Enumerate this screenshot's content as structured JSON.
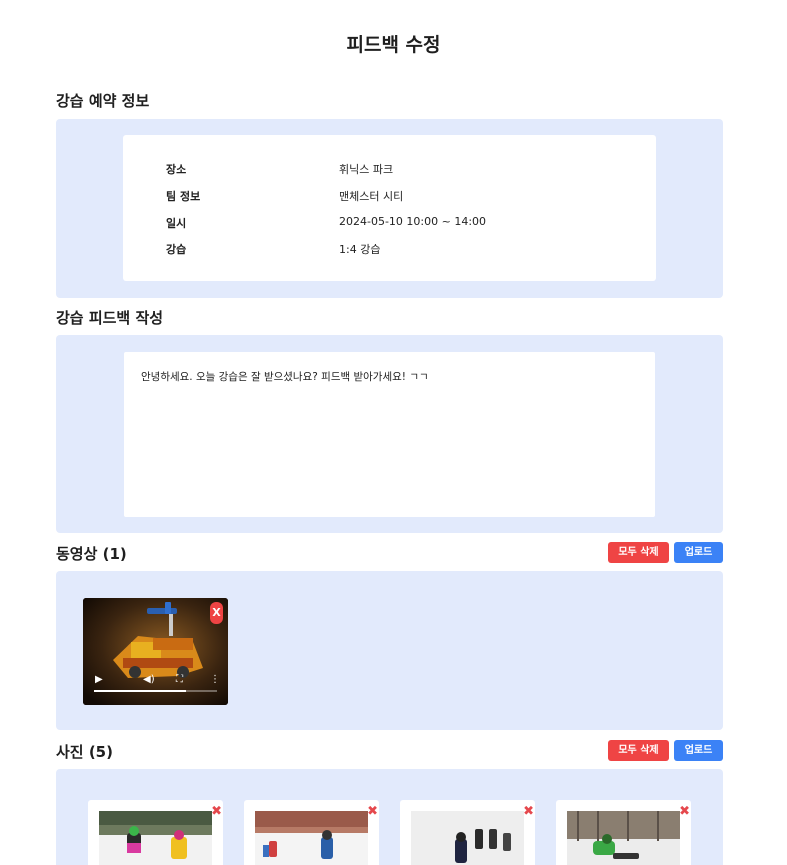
{
  "page": {
    "title": "피드백 수정"
  },
  "reservation": {
    "section_title": "강습 예약 정보",
    "rows": [
      {
        "label": "장소",
        "value": "휘닉스 파크"
      },
      {
        "label": "팀 정보",
        "value": "맨체스터 시티"
      },
      {
        "label": "일시",
        "value": "2024-05-10 10:00 ~ 14:00"
      },
      {
        "label": "강습",
        "value": "1:4 강습"
      }
    ]
  },
  "feedback": {
    "section_title": "강습 피드백 작성",
    "text": "안녕하세요. 오늘 강습은 잘 받으셨나요? 피드백 받아가세요! ㄱㄱ"
  },
  "videos": {
    "section_title": "동영상 (1)",
    "delete_all_label": "모두 삭제",
    "upload_label": "업로드",
    "close_label": "X",
    "controls": {
      "play_icon": "play-icon",
      "volume_icon": "volume-icon",
      "fullscreen_icon": "fullscreen-icon",
      "more_icon": "more-icon"
    },
    "progress": 0.75
  },
  "photos": {
    "section_title": "사진 (5)",
    "delete_all_label": "모두 삭제",
    "upload_label": "업로드",
    "close_label": "✖"
  },
  "colors": {
    "panel_bg": "#e2eafc",
    "danger": "#ef4444",
    "primary": "#3b82f6"
  }
}
